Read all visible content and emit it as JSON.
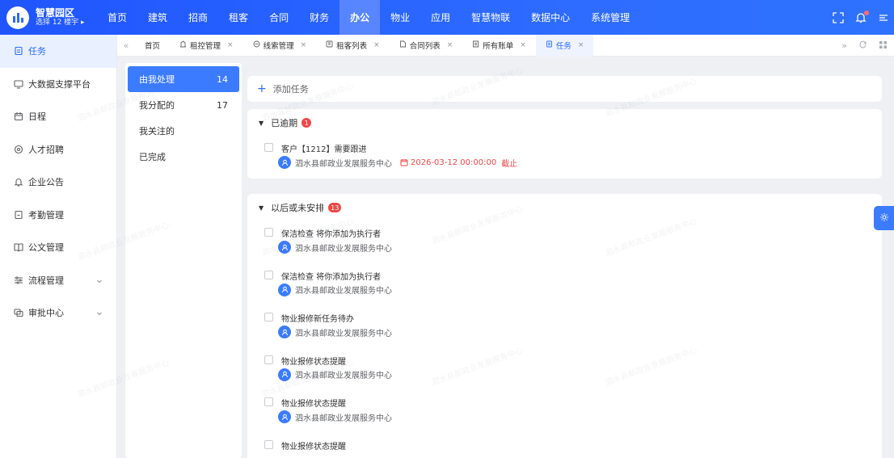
{
  "app": {
    "title": "智慧园区",
    "subtitle": "选择 12 楼宇 ▸"
  },
  "nav": {
    "items": [
      "首页",
      "建筑",
      "招商",
      "租客",
      "合同",
      "财务",
      "办公",
      "物业",
      "应用",
      "智慧物联",
      "数据中心",
      "系统管理"
    ],
    "active": "办公"
  },
  "sidebar": {
    "items": [
      {
        "label": "任务",
        "icon": "task-icon"
      },
      {
        "label": "大数据支撑平台",
        "icon": "monitor-icon"
      },
      {
        "label": "日程",
        "icon": "calendar-icon"
      },
      {
        "label": "人才招聘",
        "icon": "recruit-icon"
      },
      {
        "label": "企业公告",
        "icon": "bell-icon"
      },
      {
        "label": "考勤管理",
        "icon": "attendance-icon"
      },
      {
        "label": "公文管理",
        "icon": "book-icon"
      },
      {
        "label": "流程管理",
        "icon": "flow-icon"
      },
      {
        "label": "审批中心",
        "icon": "approval-icon"
      }
    ]
  },
  "tabs": {
    "items": [
      {
        "label": "首页"
      },
      {
        "label": "租控管理"
      },
      {
        "label": "线索管理"
      },
      {
        "label": "租客列表"
      },
      {
        "label": "合同列表"
      },
      {
        "label": "所有账单"
      },
      {
        "label": "任务"
      }
    ],
    "close": "×"
  },
  "filters": {
    "items": [
      {
        "label": "由我处理",
        "count": "14"
      },
      {
        "label": "我分配的",
        "count": "17"
      },
      {
        "label": "我关注的",
        "count": ""
      },
      {
        "label": "已完成",
        "count": ""
      }
    ]
  },
  "main": {
    "add_task": "添加任务",
    "overdue": {
      "title": "已逾期",
      "badge": "1",
      "tasks": [
        {
          "title": "客户【1212】需要跟进",
          "org": "泗水县邮政业发展服务中心",
          "due": "2026-03-12 00:00:00",
          "due_label": "截止"
        }
      ]
    },
    "later": {
      "title": "以后或未安排",
      "badge": "13",
      "tasks": [
        {
          "title": "保洁检查 将你添加为执行者",
          "org": "泗水县邮政业发展服务中心"
        },
        {
          "title": "保洁检查 将你添加为执行者",
          "org": "泗水县邮政业发展服务中心"
        },
        {
          "title": "物业报修新任务待办",
          "org": "泗水县邮政业发展服务中心"
        },
        {
          "title": "物业报修状态提醒",
          "org": "泗水县邮政业发展服务中心"
        },
        {
          "title": "物业报修状态提醒",
          "org": "泗水县邮政业发展服务中心"
        },
        {
          "title": "物业报修状态提醒",
          "org": ""
        }
      ]
    }
  },
  "watermark": "泗水县邮政业发展服务中心",
  "colors": {
    "primary": "#2b6bff",
    "danger": "#f04646"
  }
}
